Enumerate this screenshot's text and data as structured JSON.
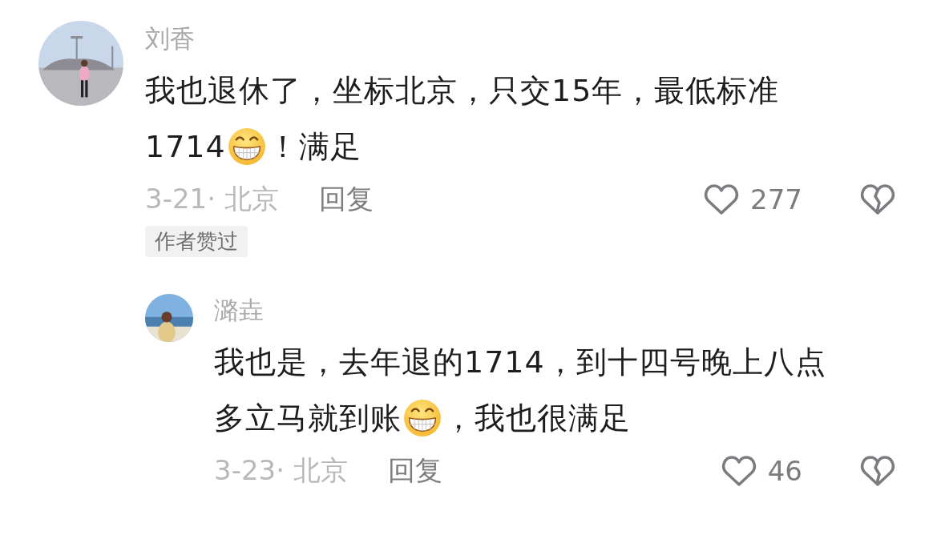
{
  "comments": [
    {
      "author": "刘香",
      "lines": [
        [
          {
            "kind": "text",
            "text": "我也退休了，坐标北京，只交15年，最低标准"
          }
        ],
        [
          {
            "kind": "text",
            "text": "1714"
          },
          {
            "kind": "emoji"
          },
          {
            "kind": "text",
            "text": "！满足"
          }
        ]
      ],
      "date": "3-21· 北京",
      "reply_label": "回复",
      "likes": "277",
      "badge": "作者赞过",
      "replies": [
        {
          "author": "潞垚",
          "lines": [
            [
              {
                "kind": "text",
                "text": "我也是，去年退的1714，到十四号晚上八点"
              }
            ],
            [
              {
                "kind": "text",
                "text": "多立马就到账"
              },
              {
                "kind": "emoji"
              },
              {
                "kind": "text",
                "text": "，我也很满足"
              }
            ]
          ],
          "date": "3-23· 北京",
          "reply_label": "回复",
          "likes": "46"
        }
      ]
    }
  ]
}
